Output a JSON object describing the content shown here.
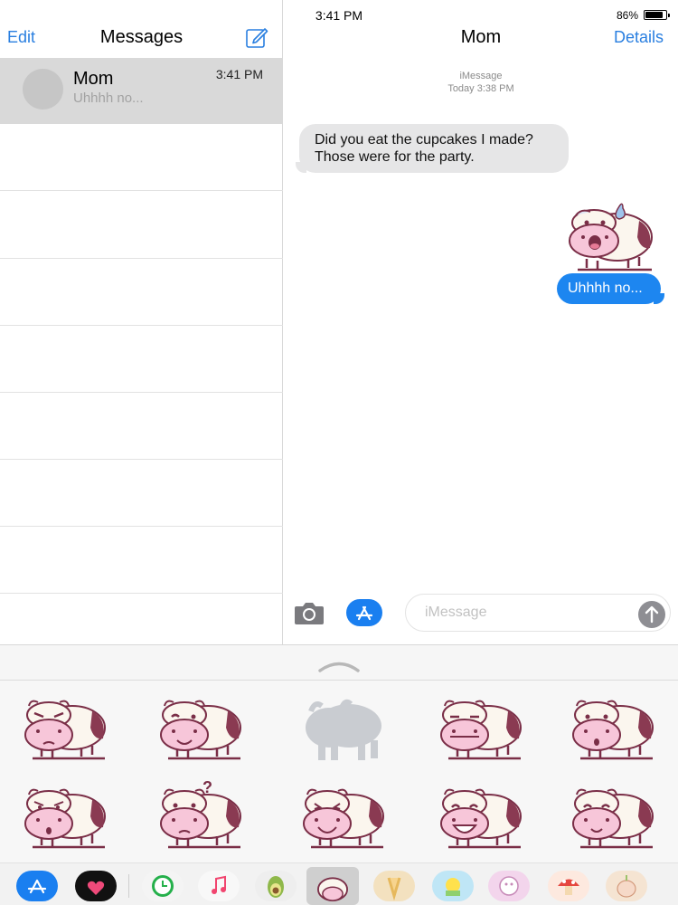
{
  "status_bar": {
    "time": "3:41 PM",
    "battery": "86%"
  },
  "left_nav": {
    "edit_label": "Edit",
    "title": "Messages"
  },
  "conversation": {
    "name": "Mom",
    "preview": "Uhhhh no...",
    "time": "3:41 PM"
  },
  "right_nav": {
    "title": "Mom",
    "details_label": "Details"
  },
  "thread_meta": {
    "service": "iMessage",
    "timestamp": "Today 3:38 PM"
  },
  "messages": {
    "incoming_line1": "Did you eat the cupcakes I made?",
    "incoming_line2": "Those  were for the party.",
    "outgoing": "Uhhhh no..."
  },
  "input": {
    "placeholder": "iMessage"
  },
  "stickers": [
    {
      "expression": "angry"
    },
    {
      "expression": "smile-wink"
    },
    {
      "expression": "placeholder-silhouette"
    },
    {
      "expression": "neutral"
    },
    {
      "expression": "surprised"
    },
    {
      "expression": "worried"
    },
    {
      "expression": "confused-question"
    },
    {
      "expression": "happy-squint"
    },
    {
      "expression": "big-smile"
    },
    {
      "expression": "happy"
    }
  ],
  "tray_apps": [
    "app-store-icon",
    "heart-sticker-icon",
    "clock-icon",
    "music-icon",
    "avocado-icon",
    "cow-sticker-icon",
    "tan-sticker-icon",
    "yellow-sticker-icon",
    "pink-sticker-icon",
    "mushroom-icon",
    "onion-icon"
  ],
  "colors": {
    "accent": "#1d86f0",
    "link": "#2a7fe0",
    "cow_pink": "#f7c6d9",
    "cow_outline": "#7a2e47",
    "cow_spot": "#8a3a52"
  }
}
